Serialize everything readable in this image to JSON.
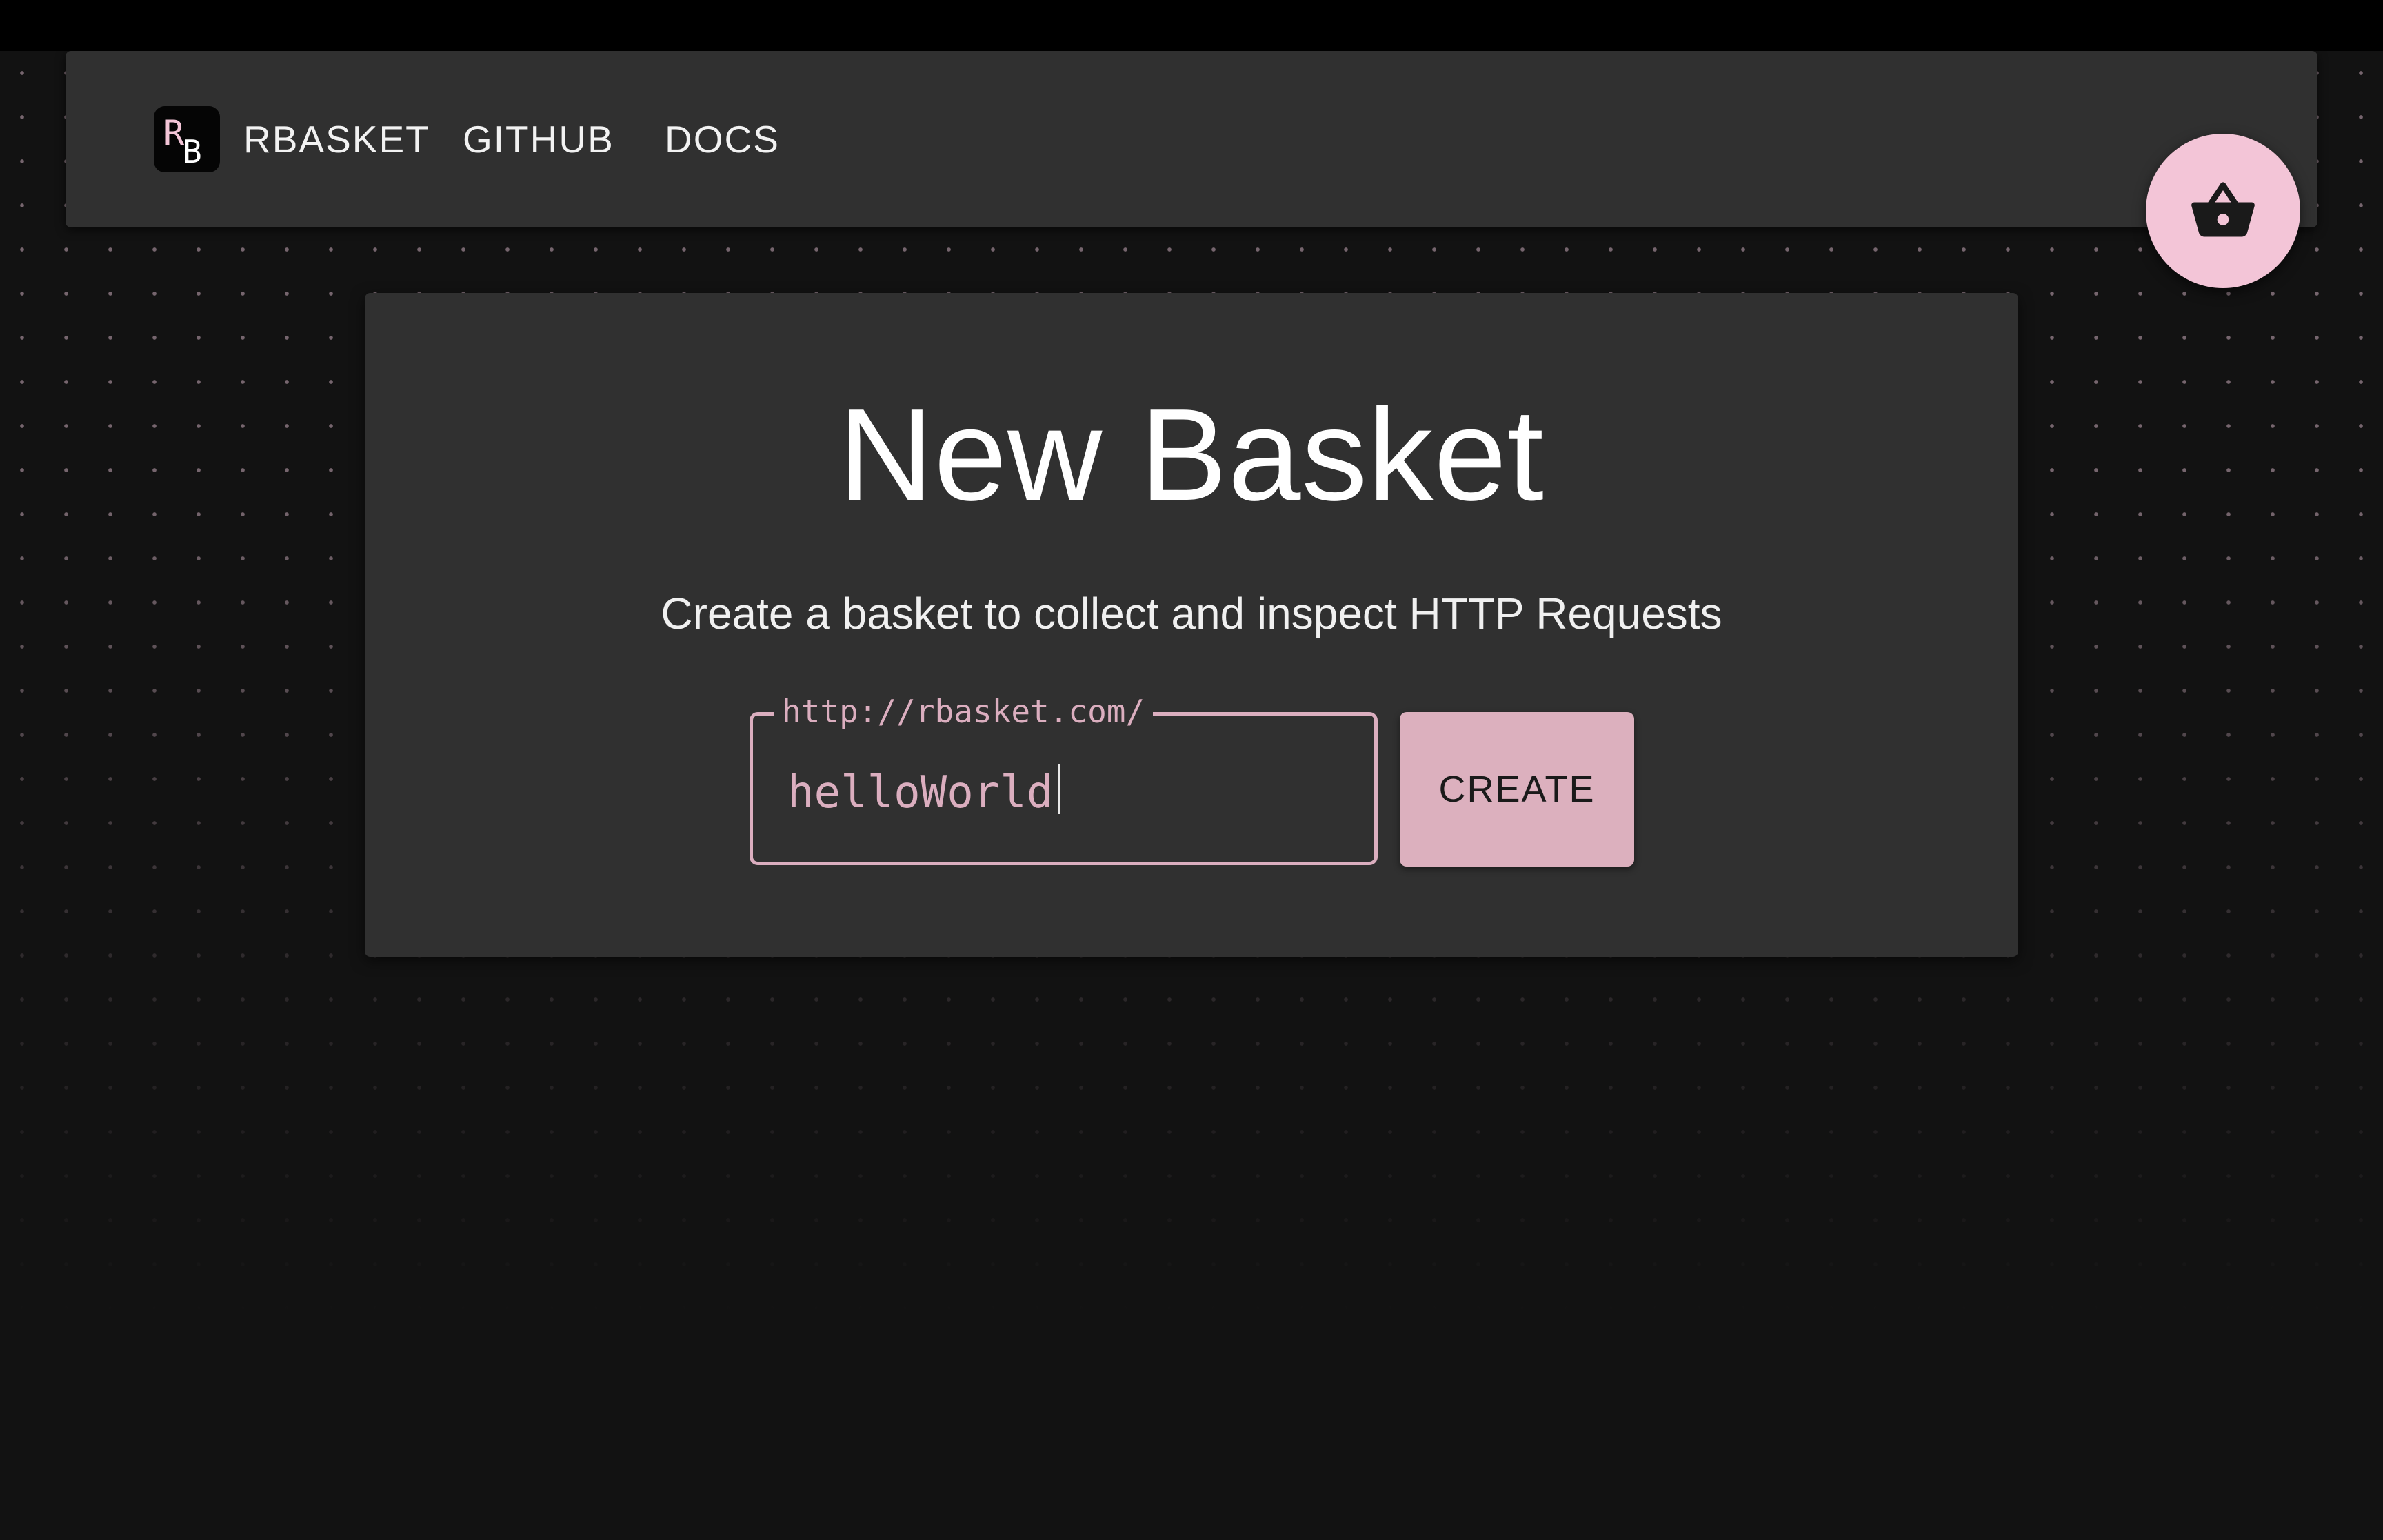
{
  "navbar": {
    "logo_text": "RB",
    "brand": "RBASKET",
    "links": [
      {
        "label": "GITHUB"
      },
      {
        "label": "DOCS"
      }
    ]
  },
  "fab": {
    "icon": "basket-icon"
  },
  "card": {
    "title": "New Basket",
    "subtitle": "Create a basket to collect and inspect HTTP Requests",
    "field": {
      "label": "http://rbasket.com/",
      "value": "helloWorld"
    },
    "button": "CREATE"
  },
  "colors": {
    "accent": "#dcb0be",
    "fab": "#f3c5d7",
    "background": "#121212",
    "surface": "#303030"
  }
}
